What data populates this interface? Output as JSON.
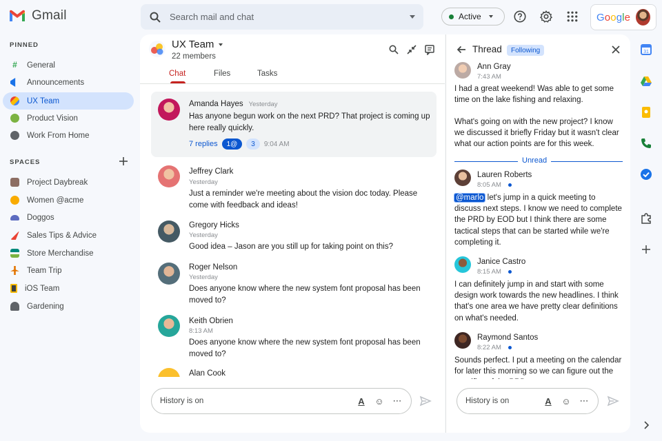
{
  "app": {
    "name": "Gmail"
  },
  "search": {
    "placeholder": "Search mail and chat"
  },
  "status": {
    "label": "Active"
  },
  "account": {
    "brand": "Google"
  },
  "sidebar": {
    "pinned_title": "PINNED",
    "pinned": [
      {
        "label": "General",
        "icon": "hash-icon",
        "color": "#34a853"
      },
      {
        "label": "Announcements",
        "icon": "megaphone-icon",
        "color": "#1a73e8"
      },
      {
        "label": "UX Team",
        "icon": "ux-team-icon",
        "color": "#fbbc04",
        "active": true
      },
      {
        "label": "Product Vision",
        "icon": "globe-icon",
        "color": "#7cb342"
      },
      {
        "label": "Work From Home",
        "icon": "home-icon",
        "color": "#5f6368"
      }
    ],
    "spaces_title": "SPACES",
    "spaces": [
      {
        "label": "Project Daybreak",
        "icon": "landscape-icon",
        "color": "#8d6e63"
      },
      {
        "label": "Women @acme",
        "icon": "smiley-icon",
        "color": "#f9ab00"
      },
      {
        "label": "Doggos",
        "icon": "dog-icon",
        "color": "#5c6bc0"
      },
      {
        "label": "Sales Tips & Advice",
        "icon": "rocket-icon",
        "color": "#ea4335"
      },
      {
        "label": "Store Merchandise",
        "icon": "store-icon",
        "color": "#00897b"
      },
      {
        "label": "Team Trip",
        "icon": "plane-icon",
        "color": "#e37400"
      },
      {
        "label": "iOS Team",
        "icon": "phone-icon",
        "color": "#3c4043"
      },
      {
        "label": "Gardening",
        "icon": "plant-icon",
        "color": "#5f6368"
      }
    ]
  },
  "room": {
    "name": "UX Team",
    "members": "22 members",
    "tabs": [
      "Chat",
      "Files",
      "Tasks"
    ]
  },
  "messages": [
    {
      "name": "Amanda Hayes",
      "time": "Yesterday",
      "text": "Has anyone begun work on the next PRD? That project is coming up here really quickly.",
      "replies": "7 replies",
      "mention_count": "1@",
      "unread_count": "3",
      "reply_time": "9:04 AM",
      "avatar": "#c2185b"
    },
    {
      "name": "Jeffrey Clark",
      "time": "Yesterday",
      "text": "Just a reminder we're meeting about the vision doc today. Please come with feedback and ideas!",
      "avatar": "#e57373"
    },
    {
      "name": "Gregory Hicks",
      "time": "Yesterday",
      "text": "Good idea – Jason are you still up for taking point on this?",
      "avatar": "#607d8b"
    },
    {
      "name": "Roger Nelson",
      "time": "Yesterday",
      "text": "Does anyone know where the new system font proposal has been moved to?",
      "avatar": "#78909c"
    },
    {
      "name": "Keith Obrien",
      "time": "8:13 AM",
      "text": "Does anyone know where the new system font proposal has been moved to?",
      "avatar": "#26a69a"
    },
    {
      "name": "Alan Cook",
      "avatar": "#fbc02d"
    }
  ],
  "composer": {
    "placeholder": "History is on"
  },
  "thread": {
    "title": "Thread",
    "following": "Following",
    "unread_label": "Unread",
    "messages": [
      {
        "name": "Ann Gray",
        "time": "7:43 AM",
        "text": "I had a great weekend! Was able to get some time on the lake fishing and relaxing.",
        "text2": "What's going on with the new project? I know we discussed it briefly Friday but it wasn't clear what our action points are for this week.",
        "avatar": "#bcaaa4"
      },
      {
        "name": "Lauren Roberts",
        "time": "8:05 AM",
        "mention": "@marlo",
        "text": " let's jump in a quick meeting to discuss next steps. I know we need to complete the PRD by EOD but I think there are some tactical steps that can be started while we're completing it.",
        "avatar": "#8d6e63"
      },
      {
        "name": "Janice Castro",
        "time": "8:15 AM",
        "text": "I can definitely jump in and start with some design work towards the new headlines. I think that's one area we have pretty clear definitions on what's needed.",
        "avatar": "#26c6da"
      },
      {
        "name": "Raymond Santos",
        "time": "8:22 AM",
        "text": "Sounds perfect. I put a meeting on the calendar for later this morning so we can figure out the specifics of the PRD.",
        "avatar": "#6d4c41"
      }
    ]
  },
  "composer_thread": {
    "placeholder": "History is on"
  }
}
